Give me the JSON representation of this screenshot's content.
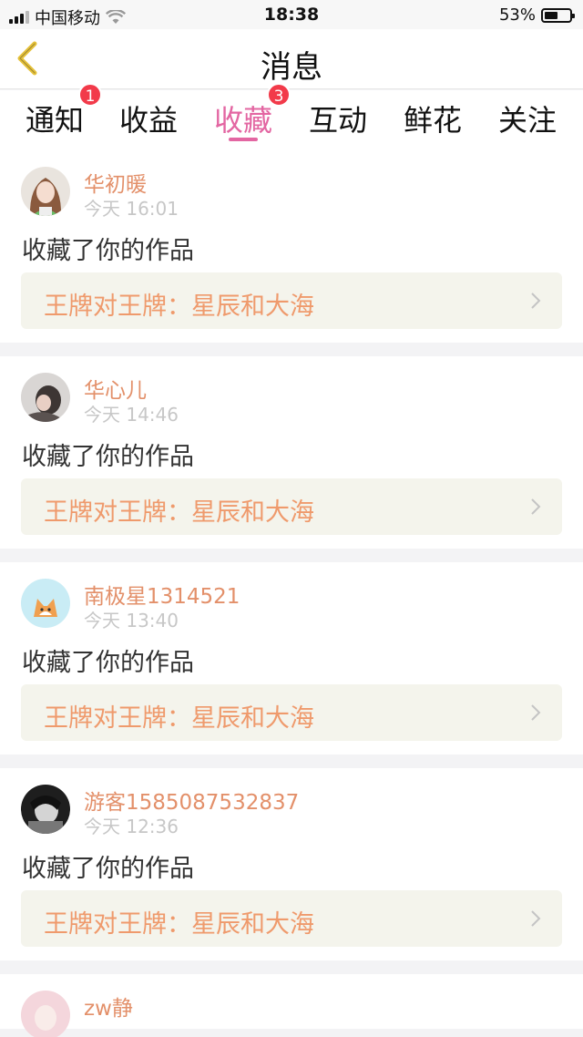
{
  "status_bar": {
    "carrier": "中国移动",
    "time": "18:38",
    "battery_percent_text": "53%",
    "battery_level": 0.53,
    "icons": [
      "signal-icon",
      "wifi-icon",
      "battery-icon"
    ]
  },
  "nav": {
    "title": "消息",
    "back_icon": "chevron-left-icon"
  },
  "tabs": [
    {
      "label": "通知",
      "badge": "1"
    },
    {
      "label": "收益",
      "badge": ""
    },
    {
      "label": "收藏",
      "badge": "3",
      "active": true
    },
    {
      "label": "互动",
      "badge": ""
    },
    {
      "label": "鲜花",
      "badge": ""
    },
    {
      "label": "关注",
      "badge": ""
    }
  ],
  "messages": [
    {
      "user": "华初暖",
      "time": "今天 16:01",
      "text": "收藏了你的作品",
      "work": "王牌对王牌：星辰和大海"
    },
    {
      "user": "华心儿",
      "time": "今天 14:46",
      "text": "收藏了你的作品",
      "work": "王牌对王牌：星辰和大海"
    },
    {
      "user": "南极星1314521",
      "time": "今天 13:40",
      "text": "收藏了你的作品",
      "work": "王牌对王牌：星辰和大海"
    },
    {
      "user": "游客1585087532837",
      "time": "今天 12:36",
      "text": "收藏了你的作品",
      "work": "王牌对王牌：星辰和大海"
    },
    {
      "user": "zw静",
      "time": "",
      "text": "",
      "work": ""
    }
  ],
  "colors": {
    "accent": "#e366a2",
    "badge": "#f23a4a",
    "username": "#e3906a",
    "work_title": "#ef9a6c",
    "back_arrow": "#e6c23a"
  }
}
